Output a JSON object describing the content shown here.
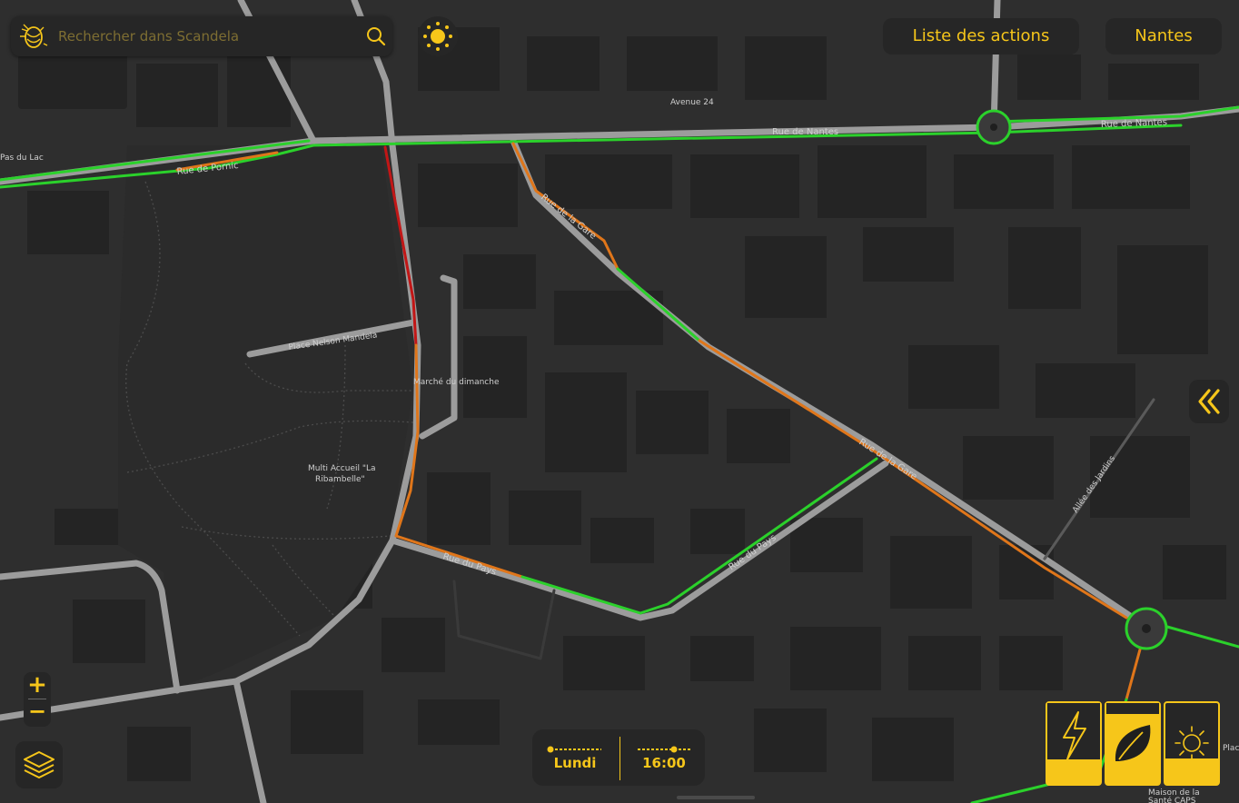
{
  "search": {
    "placeholder": "Rechercher dans Scandela",
    "logo_icon": "bee-logo-icon",
    "search_icon": "search-icon"
  },
  "theme_toggle": {
    "icon": "sun-icon"
  },
  "header": {
    "actions_label": "Liste des actions",
    "city_label": "Nantes"
  },
  "sidebar_toggle": {
    "icon": "double-chevron-left-icon"
  },
  "zoom": {
    "in_label": "+",
    "out_label": "−"
  },
  "layers": {
    "icon": "layers-icon"
  },
  "time_filter": {
    "day_label": "Lundi",
    "time_label": "16:00"
  },
  "modes": [
    {
      "name": "energy",
      "icon": "lightning-icon",
      "active": false
    },
    {
      "name": "ecology",
      "icon": "leaf-icon",
      "active": true
    },
    {
      "name": "lighting",
      "icon": "sun-icon",
      "active": false
    }
  ],
  "map_labels": {
    "avenue_24": "Avenue 24",
    "rue_de_nantes_1": "Rue de Nantes",
    "rue_de_nantes_2": "Rue de Nantes",
    "rue_de_pornic": "Rue de Pornic",
    "pas_du_lac": "Pas du Lac",
    "rue_de_la_gare_1": "Rue de la Gare",
    "rue_de_la_gare_2": "Rue de la Gare",
    "place_nelson_mandela": "Place Nelson Mandela",
    "marche_du_dimanche": "Marché du dimanche",
    "multi_accueil_1": "Multi Accueil \"La",
    "multi_accueil_2": "Ribambelle\"",
    "rue_du_pays_1": "Rue du Pays",
    "rue_du_pays_2": "Rue du Pays",
    "allee_des_jardins": "Allée des Jardins",
    "maison_sante_1": "Maison de la",
    "maison_sante_2": "Santé CAPS",
    "place": "Place"
  },
  "status_colors": {
    "good": "#2bd12b",
    "medium": "#e0761a",
    "bad": "#c21616",
    "accent": "#f6c61a"
  }
}
